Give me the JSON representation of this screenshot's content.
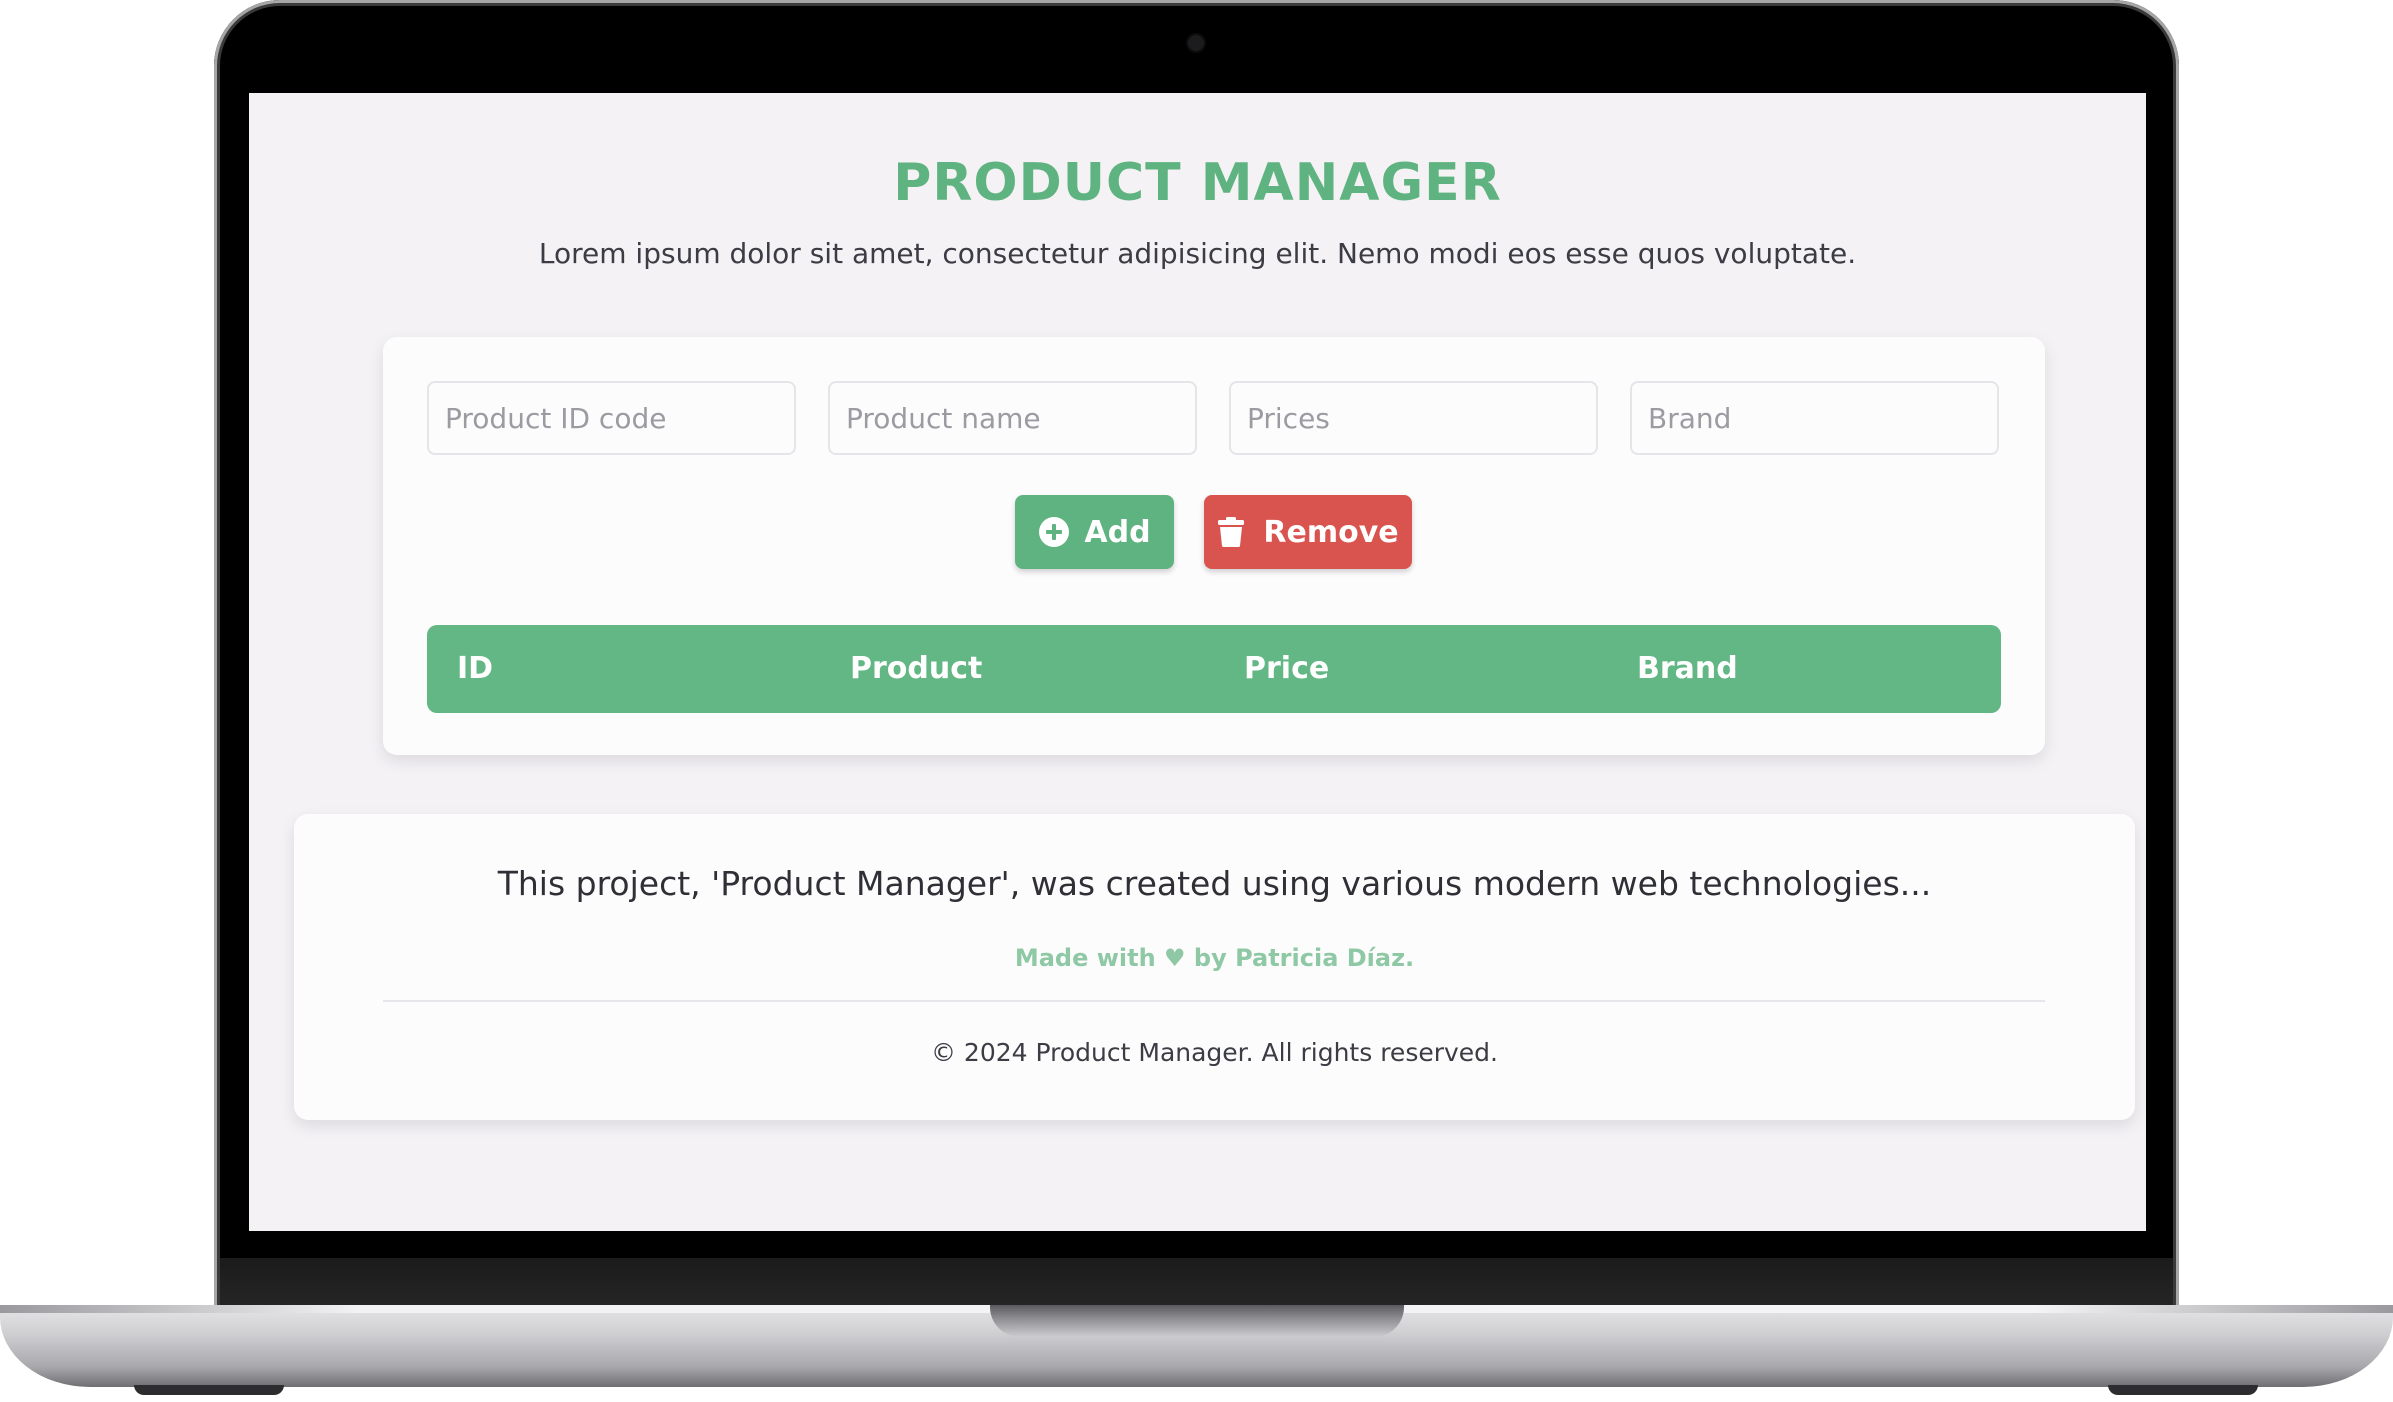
{
  "header": {
    "title": "PRODUCT MANAGER",
    "subtitle": "Lorem ipsum dolor sit amet, consectetur adipisicing elit. Nemo modi eos esse quos voluptate."
  },
  "form": {
    "fields": [
      {
        "placeholder": "Product ID code",
        "value": ""
      },
      {
        "placeholder": "Product name",
        "value": ""
      },
      {
        "placeholder": "Prices",
        "value": ""
      },
      {
        "placeholder": "Brand",
        "value": ""
      }
    ],
    "add_label": "Add",
    "remove_label": "Remove"
  },
  "table": {
    "columns": [
      "ID",
      "Product",
      "Price",
      "Brand"
    ],
    "rows": []
  },
  "footer": {
    "about": "This project, 'Product Manager', was created using various modern web technologies...",
    "made_with": "Made with ♥ by Patricia Díaz.",
    "copyright": "© 2024 Product Manager. All rights reserved."
  },
  "icons": {
    "add": "plus-circle-icon",
    "remove": "trash-icon"
  },
  "colors": {
    "accent": "#5fb380",
    "danger": "#d9534f",
    "table_header": "#62b784",
    "background": "#f4f2f5"
  }
}
